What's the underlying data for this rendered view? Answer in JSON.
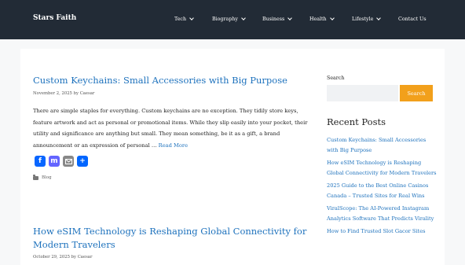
{
  "header": {
    "site_title": "Stars Faith",
    "nav": [
      {
        "label": "Tech",
        "has_dropdown": true
      },
      {
        "label": "Biography",
        "has_dropdown": true
      },
      {
        "label": "Business",
        "has_dropdown": true
      },
      {
        "label": "Health",
        "has_dropdown": true
      },
      {
        "label": "Lifestyle",
        "has_dropdown": true
      },
      {
        "label": "Contact Us",
        "has_dropdown": false
      }
    ]
  },
  "posts": [
    {
      "title": "Custom Keychains: Small Accessories with Big Purpose",
      "date": "November 2, 2025",
      "by": "by",
      "author": "Caesar",
      "excerpt": "There are simple staples for everything. Custom keychains are no exception. They tidily store keys, feature artwork and act as personal or promotional items. While they slip easily into your pocket, their utility and significance are anything but small. They mean something, be it as a gift, a brand announcement or an expression of personal …",
      "read_more": "Read More",
      "category": "Blog",
      "share_icons": [
        "facebook-icon",
        "mastodon-icon",
        "email-icon",
        "share-icon"
      ]
    },
    {
      "title": "How eSIM Technology is Reshaping Global Connectivity for Modern Travelers",
      "date": "October 29, 2025",
      "by": "by",
      "author": "Caesar"
    }
  ],
  "sidebar": {
    "search_label": "Search",
    "search_value": "",
    "search_button": "Search",
    "recent_title": "Recent Posts",
    "recent_posts": [
      "Custom Keychains: Small Accessories with Big Purpose",
      "How eSIM Technology is Reshaping Global Connectivity for Modern Travelers",
      "2025 Guide to the Best Online Casinos Canada – Trusted Sites for Real Wins",
      "ViralScope: The AI-Powered Instagram Analytics Software That Predicts Virality",
      "How to Find Trusted Slot Gacor Sites"
    ]
  },
  "colors": {
    "header_bg": "#222b36",
    "link": "#1e72bd",
    "accent": "#f2a01b",
    "page_bg": "#f7f8f9"
  }
}
